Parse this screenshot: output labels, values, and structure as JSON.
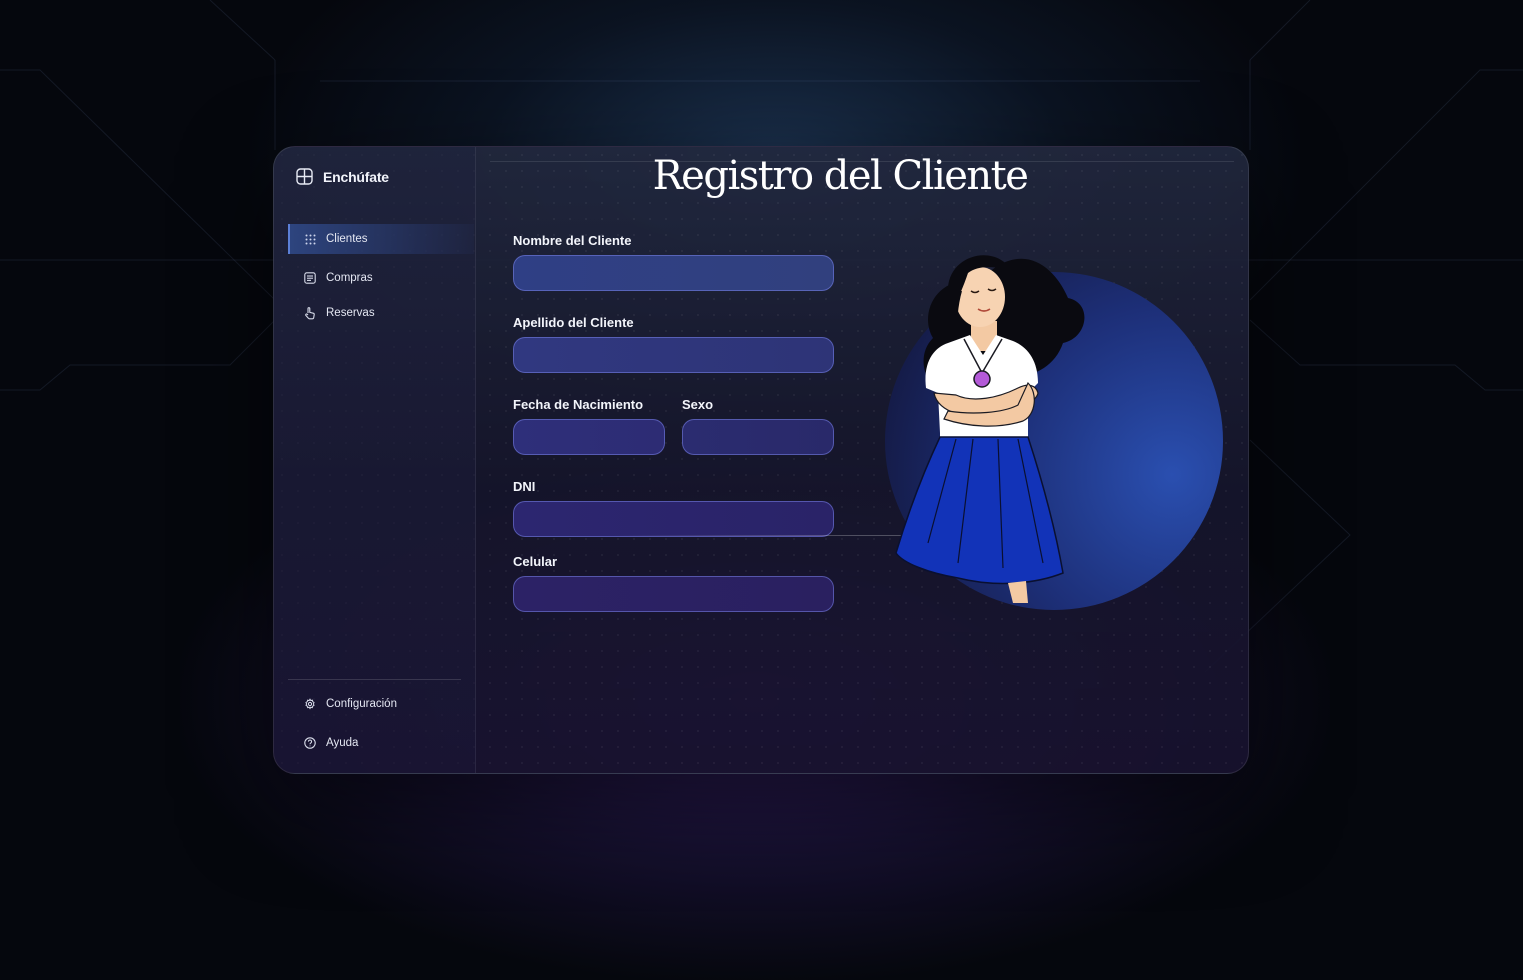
{
  "app": {
    "name": "Enchúfate"
  },
  "sidebar": {
    "items": [
      {
        "label": "Clientes",
        "icon": "grid-dots-icon",
        "active": true
      },
      {
        "label": "Compras",
        "icon": "list-doc-icon",
        "active": false
      },
      {
        "label": "Reservas",
        "icon": "hand-pointer-icon",
        "active": false
      }
    ],
    "footer_items": [
      {
        "label": "Configuración",
        "icon": "gear-icon"
      },
      {
        "label": "Ayuda",
        "icon": "help-circle-icon"
      }
    ]
  },
  "form": {
    "title": "Registro del Cliente",
    "fields": {
      "nombre": {
        "label": "Nombre del Cliente",
        "value": ""
      },
      "apellido": {
        "label": "Apellido del Cliente",
        "value": ""
      },
      "fecha": {
        "label": "Fecha de Nacimiento",
        "value": ""
      },
      "sexo": {
        "label": "Sexo",
        "value": ""
      },
      "dni": {
        "label": "DNI",
        "value": ""
      },
      "celular": {
        "label": "Celular",
        "value": ""
      }
    }
  },
  "colors": {
    "accent": "#5b7fd6",
    "circle": "#2a4aa0",
    "skirt": "#1233b8",
    "pendant": "#b45ad8"
  },
  "illustration": {
    "icon": "woman-arms-crossed-illustration"
  }
}
